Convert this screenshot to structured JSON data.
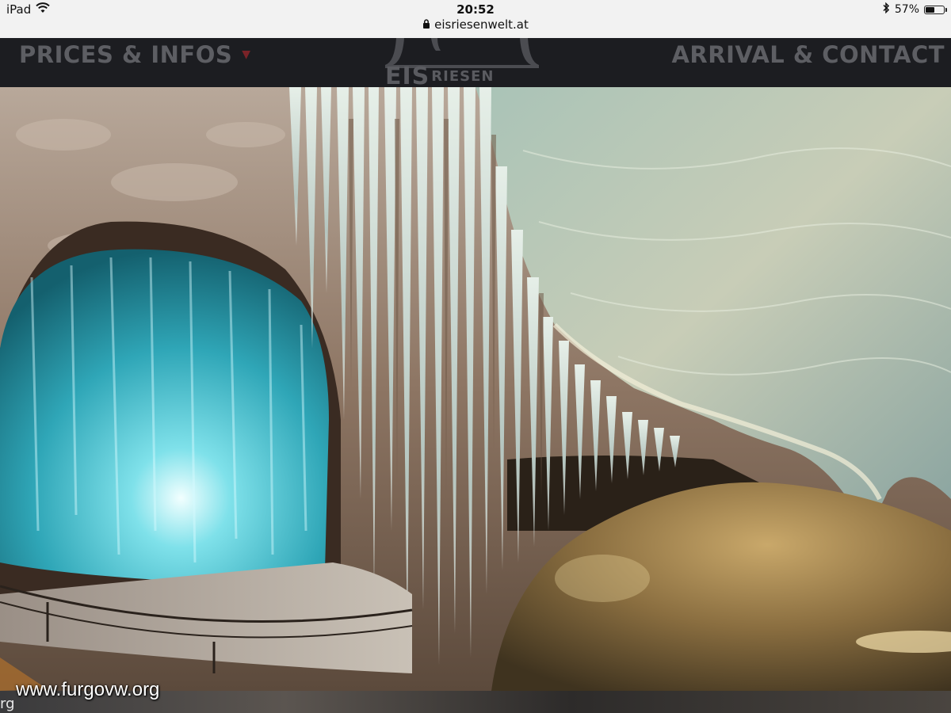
{
  "status_bar": {
    "device": "iPad",
    "time": "20:52",
    "url": "eisriesenwelt.at",
    "battery": "57%",
    "battery_level": 0.57,
    "icons": [
      "wifi-icon",
      "lock-icon",
      "bluetooth-icon",
      "battery-icon"
    ]
  },
  "site_nav": {
    "left_label": "PRICES & INFOS",
    "right_label": "ARRIVAL & CONTACT",
    "logo_text_1": "EIS",
    "logo_text_2": "RIESEN",
    "accent_color": "#7a2328"
  },
  "hero": {
    "photo": "ice cave interior with icicles and blue-lit ice formation"
  },
  "bottom": {
    "fragment": "rg"
  },
  "watermark": "www.furgovw.org"
}
